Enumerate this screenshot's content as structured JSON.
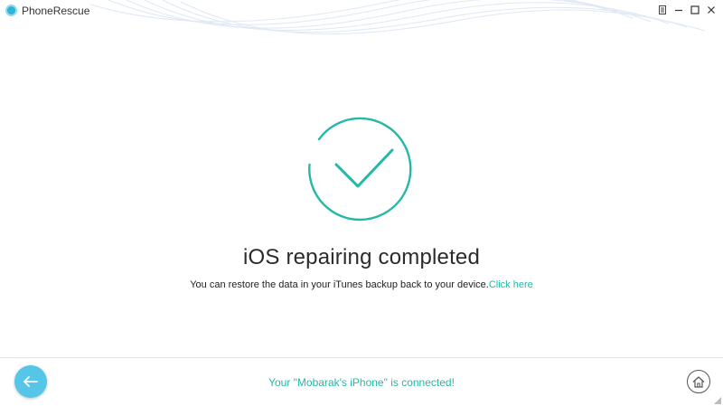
{
  "app": {
    "title": "PhoneRescue",
    "logo_icon": "phonerescue-logo-icon"
  },
  "window_controls": {
    "menu_icon": "menu-icon",
    "minimize_icon": "minimize-icon",
    "maximize_icon": "maximize-icon",
    "close_icon": "close-icon"
  },
  "main": {
    "status_icon": "check-circle-icon",
    "headline": "iOS repairing completed",
    "message": "You can restore the data in your iTunes backup back to your device.",
    "link_text": "Click here"
  },
  "footer": {
    "back_icon": "arrow-left-icon",
    "status": "Your \"Mobarak's iPhone\" is connected!",
    "home_icon": "home-icon"
  },
  "colors": {
    "accent": "#24b8a6",
    "back_button": "#55c6e8",
    "text": "#2b2b2b"
  }
}
